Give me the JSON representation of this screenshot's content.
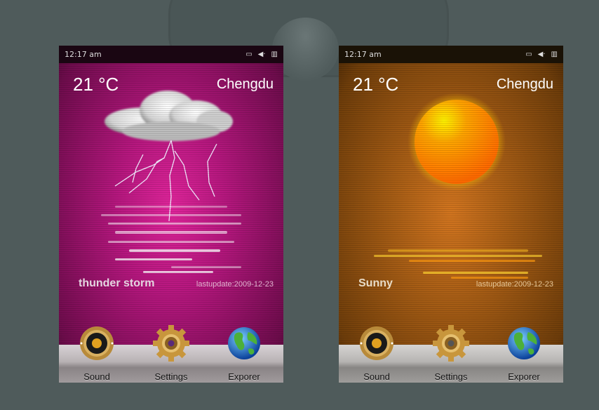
{
  "phones": [
    {
      "theme": "thunder",
      "status": {
        "time": "12:17 am",
        "icons": [
          "no-sim-icon",
          "volume-icon",
          "battery-icon"
        ]
      },
      "weather": {
        "temperature": "21 °C",
        "city": "Chengdu",
        "condition": "thunder storm",
        "last_update": "lastupdate:2009-12-23"
      },
      "dock": [
        {
          "label": "Sound",
          "icon": "speaker-icon"
        },
        {
          "label": "Settings",
          "icon": "gear-icon"
        },
        {
          "label": "Exporer",
          "icon": "globe-icon"
        }
      ],
      "accent": "#b5177e"
    },
    {
      "theme": "sunny",
      "status": {
        "time": "12:17 am",
        "icons": [
          "no-sim-icon",
          "volume-icon",
          "battery-icon"
        ]
      },
      "weather": {
        "temperature": "21 °C",
        "city": "Chengdu",
        "condition": "Sunny",
        "last_update": "lastupdate:2009-12-23"
      },
      "dock": [
        {
          "label": "Sound",
          "icon": "speaker-icon"
        },
        {
          "label": "Settings",
          "icon": "gear-icon"
        },
        {
          "label": "Exporer",
          "icon": "globe-icon"
        }
      ],
      "accent": "#a35b14"
    }
  ],
  "status_glyphs": {
    "sim": "▭",
    "volume": "◀·",
    "battery": "▥"
  }
}
